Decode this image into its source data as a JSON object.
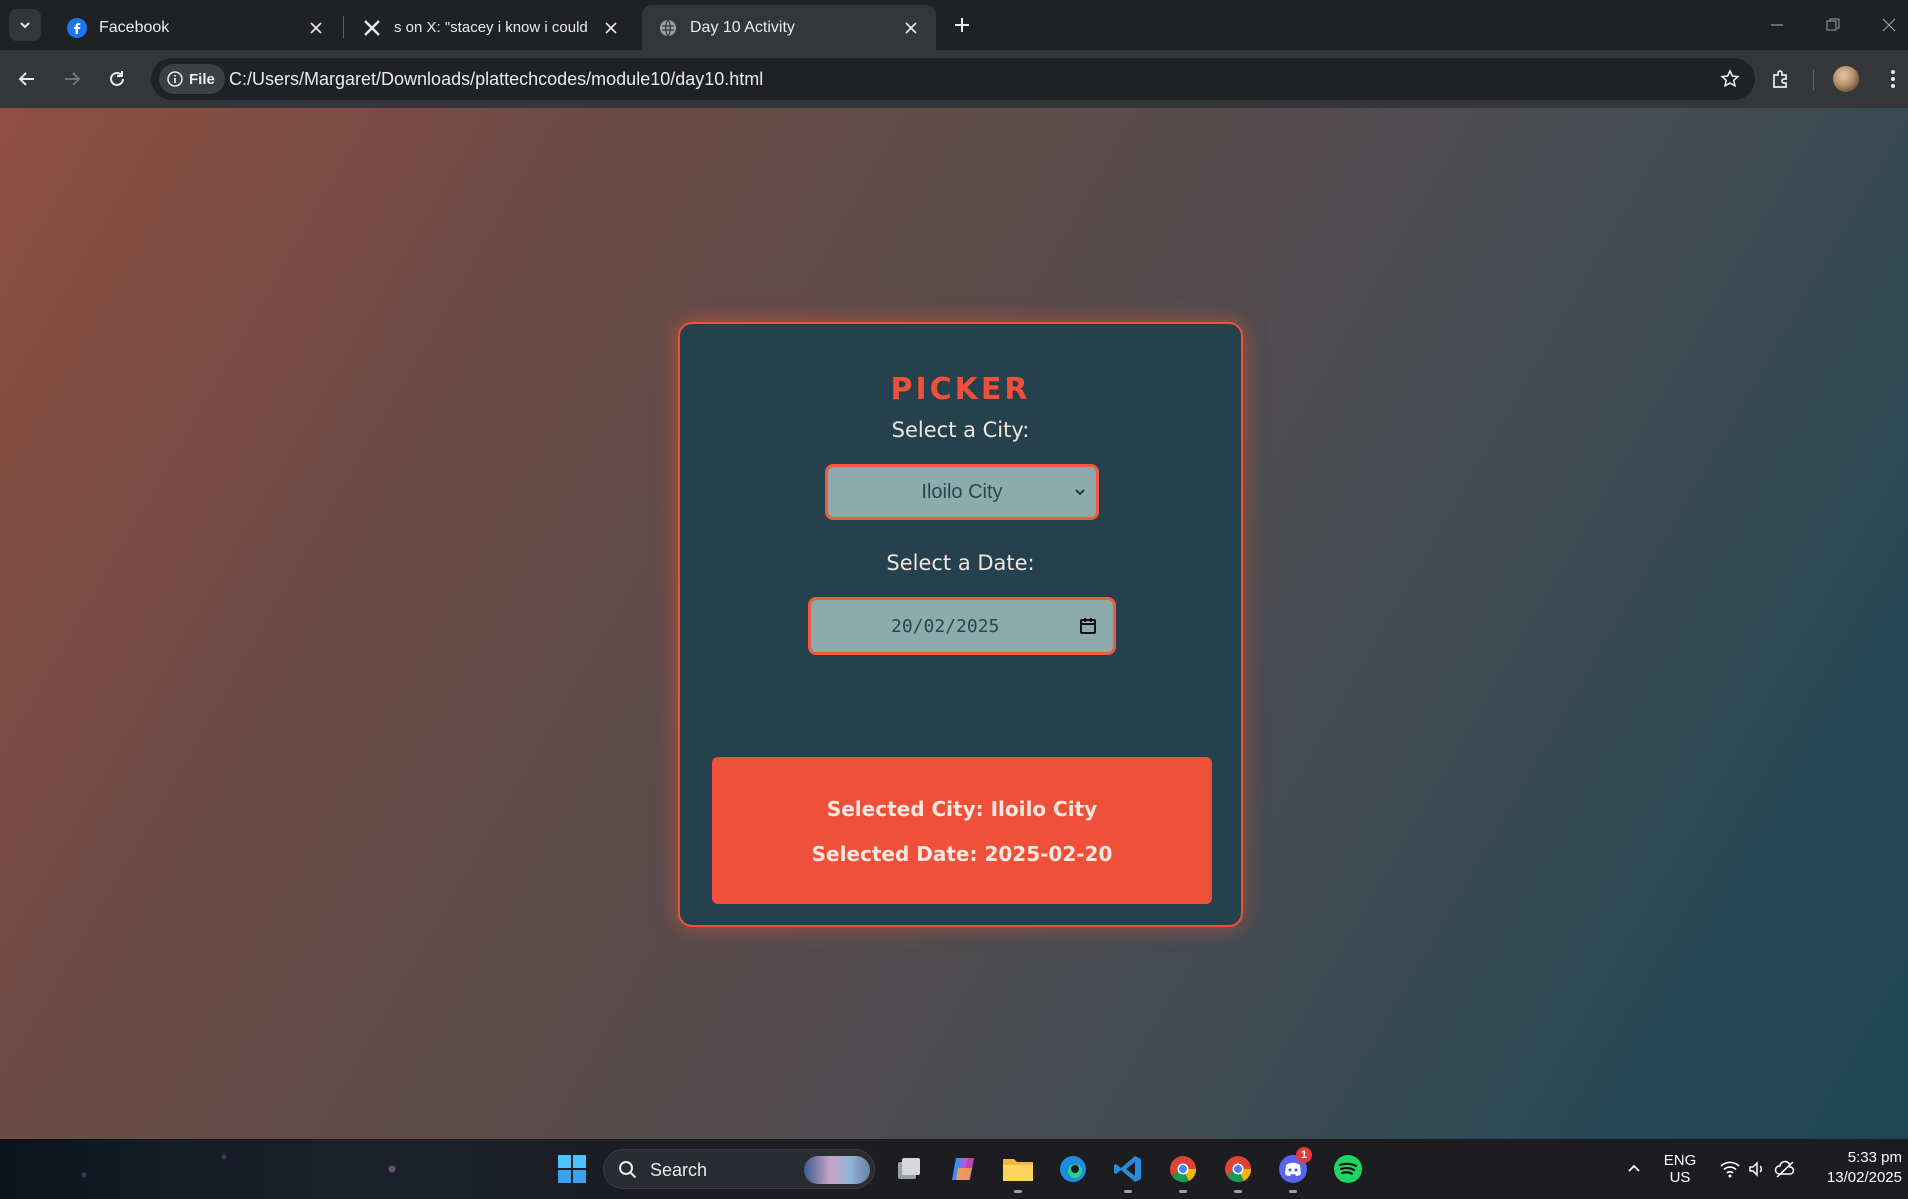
{
  "browser": {
    "tabs": [
      {
        "title": "Facebook",
        "favicon": "facebook-icon",
        "active": false
      },
      {
        "title": "s on X: \"stacey i know i could tr",
        "favicon": "x-logo-icon",
        "active": false
      },
      {
        "title": "Day 10 Activity",
        "favicon": "globe-icon",
        "active": true
      }
    ],
    "chip_label": "File",
    "url": "C:/Users/Margaret/Downloads/plattechcodes/module10/day10.html"
  },
  "page": {
    "title": "PICKER",
    "city_label": "Select a City:",
    "city_selected": "Iloilo City",
    "date_label": "Select a Date:",
    "date_value": "20/02/2025",
    "result_city": "Selected City: Iloilo City",
    "result_date": "Selected Date: 2025-02-20",
    "colors": {
      "accent": "#ef503a",
      "card": "#25414d",
      "input": "#8eabab"
    }
  },
  "taskbar": {
    "search_label": "Search",
    "lang_top": "ENG",
    "lang_bottom": "US",
    "time": "5:33 pm",
    "date": "13/02/2025",
    "discord_badge": "1"
  }
}
